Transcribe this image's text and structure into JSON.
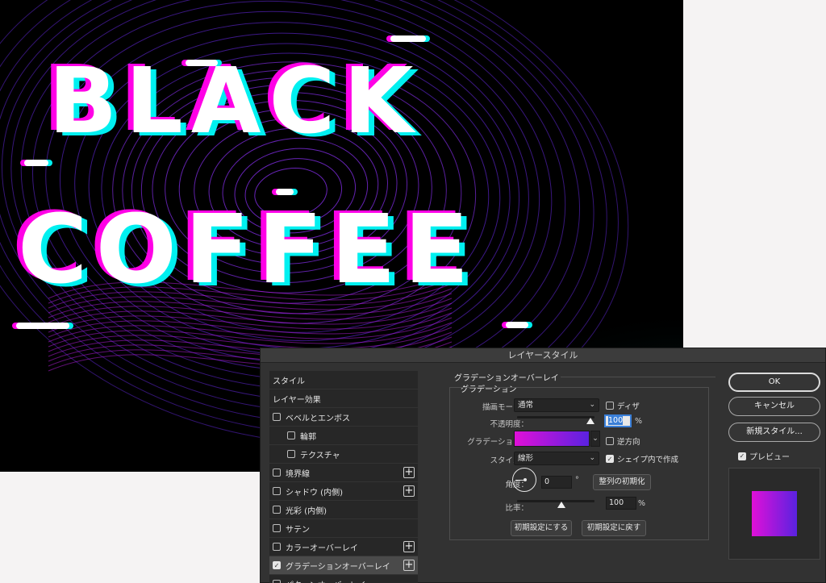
{
  "artwork": {
    "line1": "BLACK",
    "line2": "COFFEE"
  },
  "dialog": {
    "title": "レイヤースタイル",
    "style_list": [
      {
        "label": "スタイル",
        "checkbox": false,
        "checked": false,
        "plus": false,
        "indent": false,
        "selected": false
      },
      {
        "label": "レイヤー効果",
        "checkbox": false,
        "checked": false,
        "plus": false,
        "indent": false,
        "selected": false
      },
      {
        "label": "ベベルとエンボス",
        "checkbox": true,
        "checked": false,
        "plus": false,
        "indent": false,
        "selected": false
      },
      {
        "label": "輪郭",
        "checkbox": true,
        "checked": false,
        "plus": false,
        "indent": true,
        "selected": false
      },
      {
        "label": "テクスチャ",
        "checkbox": true,
        "checked": false,
        "plus": false,
        "indent": true,
        "selected": false
      },
      {
        "label": "境界線",
        "checkbox": true,
        "checked": false,
        "plus": true,
        "indent": false,
        "selected": false
      },
      {
        "label": "シャドウ (内側)",
        "checkbox": true,
        "checked": false,
        "plus": true,
        "indent": false,
        "selected": false
      },
      {
        "label": "光彩 (内側)",
        "checkbox": true,
        "checked": false,
        "plus": false,
        "indent": false,
        "selected": false
      },
      {
        "label": "サテン",
        "checkbox": true,
        "checked": false,
        "plus": false,
        "indent": false,
        "selected": false
      },
      {
        "label": "カラーオーバーレイ",
        "checkbox": true,
        "checked": false,
        "plus": true,
        "indent": false,
        "selected": false
      },
      {
        "label": "グラデーションオーバーレイ",
        "checkbox": true,
        "checked": true,
        "plus": true,
        "indent": false,
        "selected": true
      },
      {
        "label": "パターンオーバーレイ",
        "checkbox": true,
        "checked": false,
        "plus": false,
        "indent": false,
        "selected": false
      }
    ],
    "panel": {
      "section_title": "グラデーションオーバーレイ",
      "group_title": "グラデーション",
      "blend_mode_label": "描画モード：",
      "blend_mode_value": "通常",
      "dither_label": "ディザ",
      "dither_checked": false,
      "opacity_label": "不透明度：",
      "opacity_value": "100",
      "opacity_unit": "%",
      "opacity_level": 1.0,
      "gradient_label": "グラデーション：",
      "gradient_colors": [
        "#e010d8",
        "#5a22e0"
      ],
      "reverse_label": "逆方向",
      "reverse_checked": false,
      "style_label": "スタイル：",
      "style_value": "線形",
      "align_label": "シェイプ内で作成",
      "align_checked": true,
      "angle_label": "角度：",
      "angle_value": "0",
      "angle_unit": "°",
      "reset_align_button": "整列の初期化",
      "scale_label": "比率：",
      "scale_value": "100",
      "scale_unit": "%",
      "make_default_button": "初期設定にする",
      "reset_default_button": "初期設定に戻す"
    },
    "buttons": {
      "ok": "OK",
      "cancel": "キャンセル",
      "new_style": "新規スタイル...",
      "preview_label": "プレビュー",
      "preview_checked": true
    },
    "colors": {
      "accent": "#3a7fd8",
      "gradient_start": "#e010d8",
      "gradient_end": "#5a22e0"
    }
  }
}
